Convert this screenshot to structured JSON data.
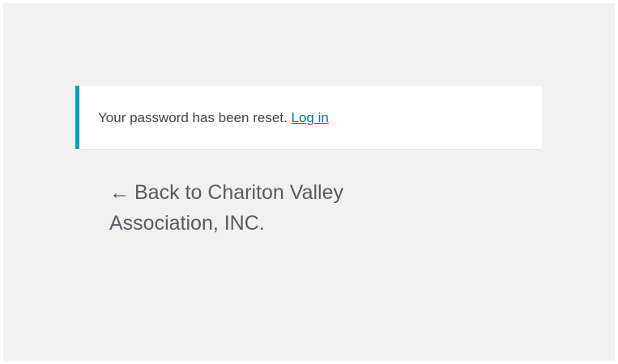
{
  "notice": {
    "message": "Your password has been reset.",
    "link_label": "Log in",
    "accent_color": "#00a0d2"
  },
  "back_link": {
    "arrow": "←",
    "label": "Back to Chariton Valley Association, INC."
  },
  "colors": {
    "background": "#f1f1f1",
    "link": "#0073aa",
    "text": "#444444"
  }
}
